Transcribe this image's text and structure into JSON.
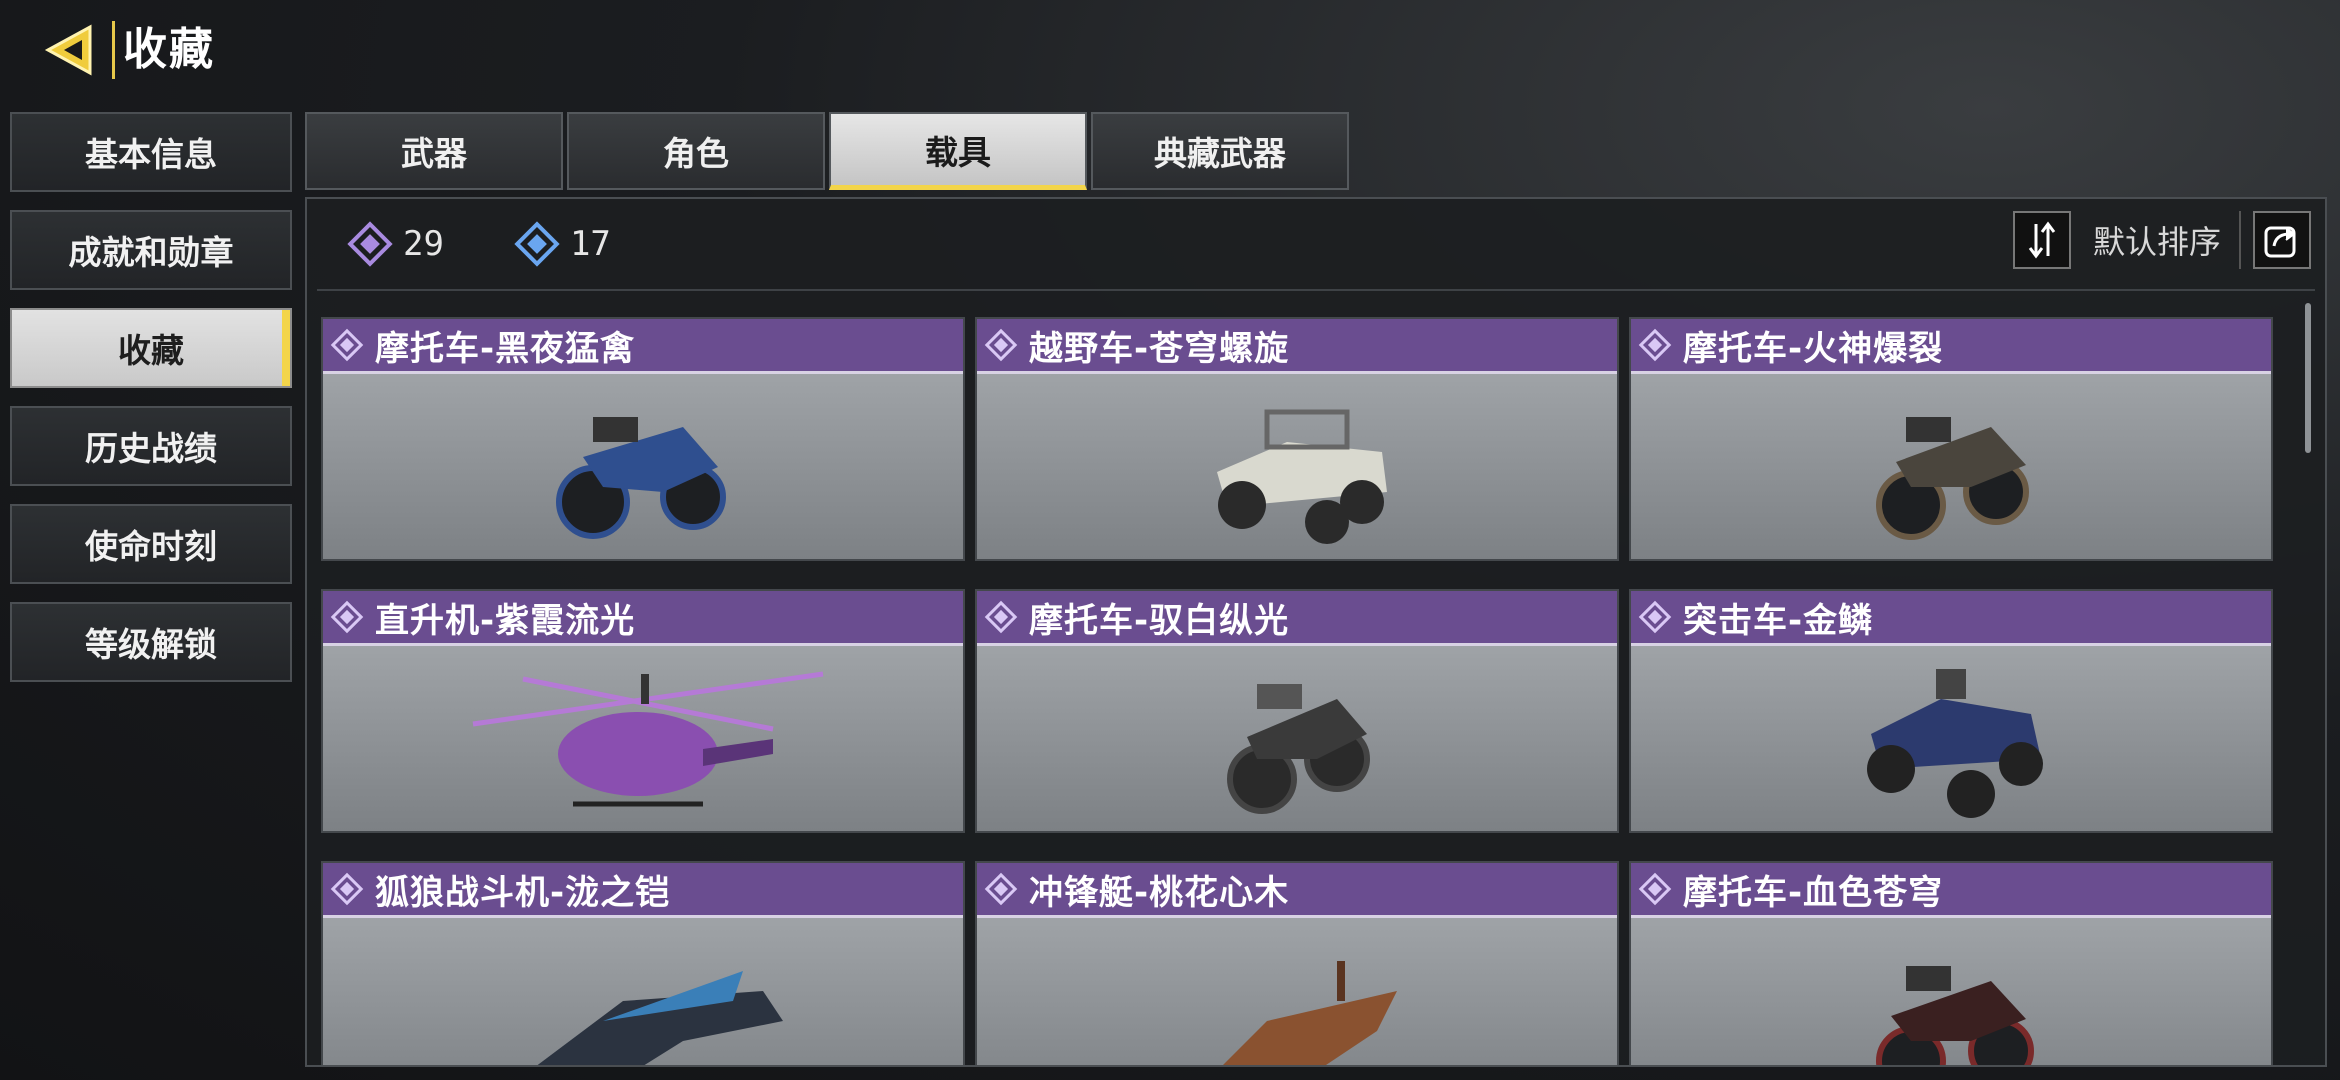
{
  "header": {
    "title": "收藏"
  },
  "sidebar": {
    "items": [
      {
        "label": "基本信息"
      },
      {
        "label": "成就和勋章"
      },
      {
        "label": "收藏",
        "active": true
      },
      {
        "label": "历史战绩"
      },
      {
        "label": "使命时刻"
      },
      {
        "label": "等级解锁"
      }
    ]
  },
  "tabs": [
    {
      "label": "武器"
    },
    {
      "label": "角色"
    },
    {
      "label": "载具",
      "active": true
    },
    {
      "label": "典藏武器"
    }
  ],
  "counts": {
    "purple": {
      "value": "29",
      "icon": "purple-diamond-icon",
      "color": "#a98be0"
    },
    "blue": {
      "value": "17",
      "icon": "blue-diamond-icon",
      "color": "#6aa6f0"
    }
  },
  "sort": {
    "label": "默认排序"
  },
  "cards": [
    {
      "name": "摩托车-黑夜猛禽",
      "type": "motorcycle",
      "tint": "#2f4f8f"
    },
    {
      "name": "越野车-苍穹螺旋",
      "type": "buggy",
      "tint": "#d9d9cf"
    },
    {
      "name": "摩托车-火神爆裂",
      "type": "motorcycle",
      "tint": "#6a5a45"
    },
    {
      "name": "直升机-紫霞流光",
      "type": "helicopter",
      "tint": "#8a4fb0"
    },
    {
      "name": "摩托车-驭白纵光",
      "type": "motorcycle",
      "tint": "#3a3a3a"
    },
    {
      "name": "突击车-金鳞",
      "type": "buggy",
      "tint": "#2c3a6e"
    },
    {
      "name": "狐狼战斗机-泷之铠",
      "type": "jet",
      "tint": "#3a7fb8"
    },
    {
      "name": "冲锋艇-桃花心木",
      "type": "boat",
      "tint": "#8a5230"
    },
    {
      "name": "摩托车-血色苍穹",
      "type": "motorcycle",
      "tint": "#7a2a2a"
    }
  ],
  "colors": {
    "accent": "#f3d54a",
    "card_header": "#6a4d90"
  }
}
